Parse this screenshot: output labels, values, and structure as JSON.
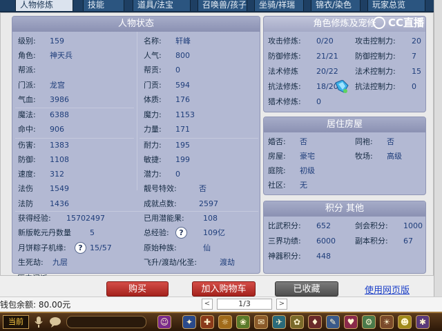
{
  "tabs": [
    {
      "label": "人物修炼",
      "active": true
    },
    {
      "label": "技能",
      "active": false
    },
    {
      "label": "道具/法宝",
      "active": false
    },
    {
      "label": "召唤兽/孩子",
      "active": false
    },
    {
      "label": "坐骑/祥瑞",
      "active": false
    },
    {
      "label": "锦衣/染色",
      "active": false
    },
    {
      "label": "玩家总览",
      "active": false
    }
  ],
  "character": {
    "title": "人物状态",
    "col1": [
      {
        "label": "级别:",
        "value": "159"
      },
      {
        "label": "角色:",
        "value": "神天兵"
      },
      {
        "label": "帮派:",
        "value": ""
      },
      {
        "label": "门派:",
        "value": "龙宫"
      },
      {
        "label": "气血:",
        "value": "3986"
      },
      {
        "label": "魔法:",
        "value": "6388"
      },
      {
        "label": "命中:",
        "value": "906"
      },
      {
        "label": "伤害:",
        "value": "1383"
      },
      {
        "label": "防御:",
        "value": "1108"
      },
      {
        "label": "速度:",
        "value": "312"
      },
      {
        "label": "法伤",
        "value": "1549"
      },
      {
        "label": "法防",
        "value": "1436"
      }
    ],
    "col2": [
      {
        "label": "名称:",
        "value": "轩峰"
      },
      {
        "label": "人气:",
        "value": "800"
      },
      {
        "label": "帮贡:",
        "value": "0"
      },
      {
        "label": "门贡:",
        "value": "594"
      },
      {
        "label": "体质:",
        "value": "176"
      },
      {
        "label": "魔力:",
        "value": "1153"
      },
      {
        "label": "力量:",
        "value": "171"
      },
      {
        "label": "耐力:",
        "value": "195"
      },
      {
        "label": "敏捷:",
        "value": "199"
      },
      {
        "label": "潜力:",
        "value": "0"
      },
      {
        "label": "靓号特效:",
        "value": "否"
      },
      {
        "label": "成就点数:",
        "value": "2597"
      }
    ],
    "extra": {
      "exp_label": "获得经验:",
      "exp_value": "15702497",
      "used_potential_label": "已用潜能果:",
      "used_potential_value": "108",
      "qiankun_label": "新版乾元丹数量",
      "qiankun_value": "5",
      "total_exp_label": "总经验:",
      "total_exp_value": "109亿",
      "mooncake_label": "月饼粽子机缘:",
      "mooncake_value": "15/57",
      "race_label": "原始种族:",
      "race_value": "仙",
      "lifedeath_label": "生死劫:",
      "lifedeath_value": "九层",
      "ascend_label": "飞升/渡劫/化圣:",
      "ascend_value": "渡劫",
      "history_label": "历史门派:",
      "history_value": "",
      "help_glyph": "?"
    }
  },
  "cultivation": {
    "title": "角色修炼及宠修",
    "rows": [
      {
        "l1": "攻击修炼:",
        "v1": "0/20",
        "l2": "攻击控制力:",
        "v2": "20"
      },
      {
        "l1": "防御修炼:",
        "v1": "21/21",
        "l2": "防御控制力:",
        "v2": "7"
      },
      {
        "l1": "法术修炼",
        "v1": "20/22",
        "l2": "法术控制力:",
        "v2": "15"
      },
      {
        "l1": "抗法修炼:",
        "v1": "18/20",
        "l2": "抗法控制力:",
        "v2": "0"
      },
      {
        "l1": "猎术修炼:",
        "v1": "0",
        "l2": "",
        "v2": ""
      }
    ]
  },
  "housing": {
    "title": "居住房屋",
    "rows": [
      {
        "l1": "婚否:",
        "v1": "否",
        "l2": "同袍:",
        "v2": "否"
      },
      {
        "l1": "房屋:",
        "v1": "豪宅",
        "l2": "牧场:",
        "v2": "高级"
      },
      {
        "l1": "庭院:",
        "v1": "初级",
        "l2": "",
        "v2": ""
      },
      {
        "l1": "社区:",
        "v1": "无",
        "l2": "",
        "v2": ""
      }
    ]
  },
  "points": {
    "title": "积分 其他",
    "rows": [
      {
        "l1": "比武积分:",
        "v1": "652",
        "l2": "剑会积分:",
        "v2": "1000"
      },
      {
        "l1": "三界功绩:",
        "v1": "6000",
        "l2": "副本积分:",
        "v2": "67"
      },
      {
        "l1": "神器积分:",
        "v1": "448",
        "l2": "",
        "v2": ""
      }
    ]
  },
  "actions": {
    "buy": "购买",
    "cart": "加入购物车",
    "collected": "已收藏",
    "web": "使用网页版"
  },
  "footer": {
    "balance": "钱包余额: 80.00元",
    "page": "1/3",
    "prev_glyph": "<",
    "next_glyph": ">",
    "current": "当前"
  },
  "watermark": "CC直播",
  "colors": {
    "panel": "#b3b9d3",
    "header": "#8b91b3",
    "value": "#1e3d7a",
    "red_button": "#b8312b",
    "gray_button": "#5a5a5a",
    "link": "#1a3ec8"
  },
  "icons": [
    "help-icon",
    "gem-icon",
    "microphone-icon",
    "chat-icon",
    "cc-logo-icon"
  ]
}
